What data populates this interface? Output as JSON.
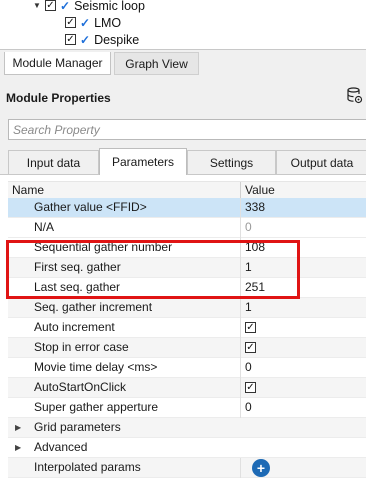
{
  "tree": {
    "items": [
      {
        "label": "Seismic loop",
        "checked": true
      },
      {
        "label": "LMO",
        "checked": true
      },
      {
        "label": "Despike",
        "checked": true
      }
    ]
  },
  "bottom_tabs": [
    {
      "label": "Module Manager",
      "active": true
    },
    {
      "label": "Graph View",
      "active": false
    }
  ],
  "module_properties": {
    "title": "Module Properties",
    "icon": "database-settings-icon"
  },
  "search": {
    "placeholder": "Search Property",
    "value": ""
  },
  "tabs": [
    {
      "label": "Input data",
      "active": false
    },
    {
      "label": "Parameters",
      "active": true
    },
    {
      "label": "Settings",
      "active": false
    },
    {
      "label": "Output data",
      "active": false
    }
  ],
  "grid": {
    "columns": {
      "name": "Name",
      "value": "Value"
    },
    "rows": [
      {
        "name": "Gather value <FFID>",
        "value": "338",
        "type": "text"
      },
      {
        "name": "N/A",
        "value": "0",
        "type": "text",
        "muted": true
      },
      {
        "name": "Sequential gather number",
        "value": "108",
        "type": "text"
      },
      {
        "name": "First seq. gather",
        "value": "1",
        "type": "text"
      },
      {
        "name": "Last seq. gather",
        "value": "251",
        "type": "text"
      },
      {
        "name": "Seq. gather increment",
        "value": "1",
        "type": "text"
      },
      {
        "name": "Auto increment",
        "value": true,
        "type": "checkbox"
      },
      {
        "name": "Stop in error case",
        "value": true,
        "type": "checkbox"
      },
      {
        "name": "Movie time delay <ms>",
        "value": "0",
        "type": "text"
      },
      {
        "name": "AutoStartOnClick",
        "value": true,
        "type": "checkbox"
      },
      {
        "name": "Super gather apperture",
        "value": "0",
        "type": "text"
      },
      {
        "name": "Grid parameters",
        "type": "group"
      },
      {
        "name": "Advanced",
        "type": "group"
      },
      {
        "name": "Interpolated params",
        "type": "add"
      }
    ]
  },
  "colors": {
    "selection": "#cce4f7",
    "highlight_box": "#e01414",
    "check_blue": "#1e6fd9",
    "add_button": "#1d6ab5"
  }
}
